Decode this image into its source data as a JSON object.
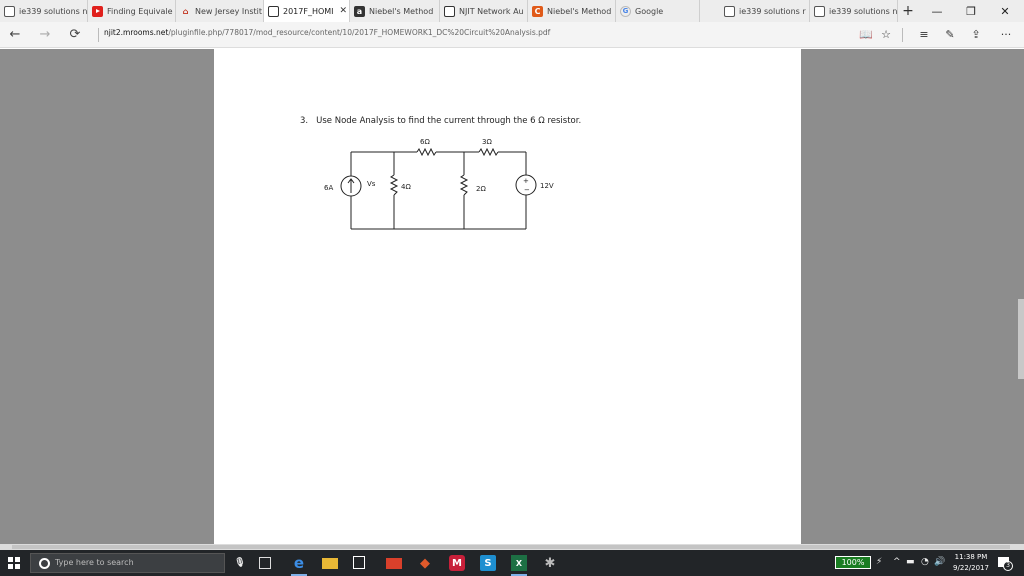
{
  "tabs": [
    {
      "icon": "document-icon",
      "label": "ie339 solutions n"
    },
    {
      "icon": "youtube-icon",
      "label": "Finding Equivale"
    },
    {
      "icon": "njit-icon",
      "label": "New Jersey Instit"
    },
    {
      "icon": "page-icon",
      "label": "2017F_HOMI",
      "active": true,
      "close": "✕"
    },
    {
      "icon": "amazon-icon",
      "label": "Niebel's Method",
      "glyph": "a"
    },
    {
      "icon": "page-icon",
      "label": "NJIT Network Au"
    },
    {
      "icon": "chegg-icon",
      "label": "Niebel's Method",
      "glyph": "C"
    },
    {
      "icon": "google-icon",
      "label": "Google",
      "glyph": "G"
    },
    {
      "icon": "document-icon",
      "label": "ie339 solutions r"
    },
    {
      "icon": "document-icon",
      "label": "ie339 solutions n"
    }
  ],
  "newtab_glyph": "+",
  "window": {
    "minimize": "—",
    "maximize": "❐",
    "close": "✕"
  },
  "nav": {
    "back": "←",
    "forward": "→",
    "refresh": "⟳"
  },
  "address": {
    "host": "njit2.mrooms.net",
    "path": "/pluginfile.php/778017/mod_resource/content/10/2017F_HOMEWORK1_DC%20Circuit%20Analysis.pdf"
  },
  "toolbar": {
    "reading_view": "📖",
    "favorite": "☆",
    "hub": "≡",
    "notes": "✎",
    "share": "⇪",
    "more": "···"
  },
  "document": {
    "question_number": "3.",
    "question_text": "Use Node Analysis to find the current through the 6 Ω resistor.",
    "circuit": {
      "r1_label": "6Ω",
      "r2_label": "3Ω",
      "current_source_label": "6A",
      "node_label": "Vs",
      "r3_label": "4Ω",
      "r4_label": "2Ω",
      "voltage_source_label": "12V"
    }
  },
  "taskbar": {
    "search_placeholder": "Type here to search",
    "battery": "100%",
    "time": "11:38 PM",
    "date": "9/22/2017",
    "notification_count": "3"
  },
  "colors": {
    "tabbar_bg": "#ededed",
    "viewer_bg": "#8d8d8d",
    "taskbar_bg": "#222528",
    "battery_green": "#1a7d22"
  }
}
